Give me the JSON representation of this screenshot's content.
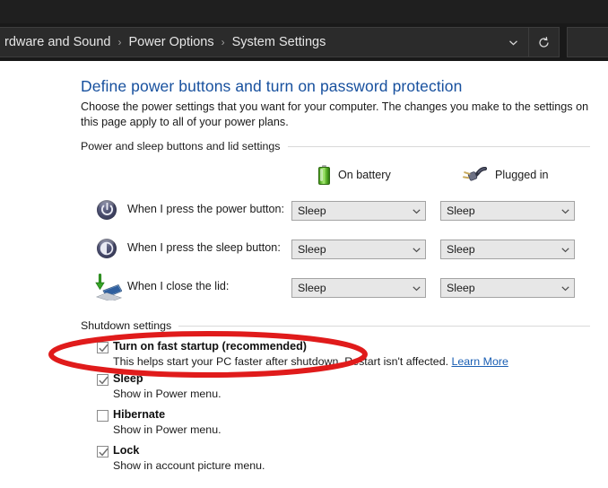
{
  "window": {
    "breadcrumb": [
      {
        "label": "rdware and Sound",
        "truncated": true
      },
      {
        "label": "Power Options"
      },
      {
        "label": "System Settings"
      }
    ],
    "separator": "›",
    "history_dropdown_icon": "chevron-down-icon",
    "refresh_icon": "refresh-icon"
  },
  "main": {
    "title": "Define power buttons and turn on password protection",
    "description": "Choose the power settings that you want for your computer. The changes you make to the settings on this page apply to all of your power plans.",
    "title_color": "#17509e"
  },
  "buttons_group": {
    "header": "Power and sleep buttons and lid settings",
    "columns": [
      {
        "icon": "battery-icon",
        "label": "On battery"
      },
      {
        "icon": "power-plug-icon",
        "label": "Plugged in"
      }
    ],
    "rows": [
      {
        "icon": "power-button-icon",
        "label": "When I press the power button:",
        "on_battery": "Sleep",
        "plugged_in": "Sleep"
      },
      {
        "icon": "sleep-button-icon",
        "label": "When I press the sleep button:",
        "on_battery": "Sleep",
        "plugged_in": "Sleep"
      },
      {
        "icon": "laptop-lid-icon",
        "label": "When I close the lid:",
        "on_battery": "Sleep",
        "plugged_in": "Sleep"
      }
    ],
    "dropdown_icon": "chevron-down-icon"
  },
  "shutdown_group": {
    "header": "Shutdown settings",
    "items": [
      {
        "label": "Turn on fast startup (recommended)",
        "checked": true,
        "sub": "This helps start your PC faster after shutdown. Restart isn't affected.",
        "link": "Learn More",
        "highlighted": true
      },
      {
        "label": "Sleep",
        "checked": true,
        "sub": "Show in Power menu.",
        "link": "",
        "highlighted": false
      },
      {
        "label": "Hibernate",
        "checked": false,
        "sub": "Show in Power menu.",
        "link": "",
        "highlighted": false
      },
      {
        "label": "Lock",
        "checked": true,
        "sub": "Show in account picture menu.",
        "link": "",
        "highlighted": false
      }
    ]
  },
  "annotation": {
    "shape": "ellipse",
    "color": "#e01b1b",
    "stroke_width": 6,
    "target": "Turn on fast startup (recommended)"
  }
}
